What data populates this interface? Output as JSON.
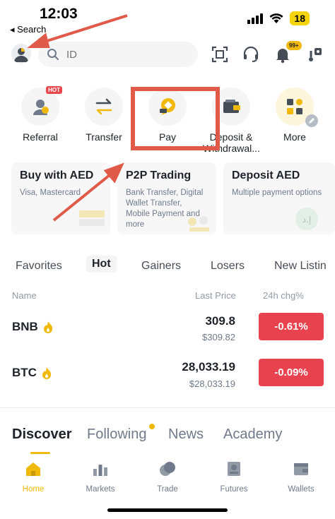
{
  "status_bar": {
    "time": "12:03",
    "back_label": "◂ Search",
    "battery": "18"
  },
  "header": {
    "search_placeholder": "ID",
    "notification_badge": "99+"
  },
  "quick_actions": [
    {
      "label": "Referral",
      "tag": "HOT"
    },
    {
      "label": "Transfer"
    },
    {
      "label": "Pay"
    },
    {
      "label": "Deposit &\nWithdrawal..."
    },
    {
      "label": "More"
    }
  ],
  "cards": [
    {
      "title": "Buy with AED",
      "subtitle": "Visa, Mastercard"
    },
    {
      "title": "P2P Trading",
      "subtitle": "Bank Transfer, Digital Wallet Transfer, Mobile Payment and more"
    },
    {
      "title": "Deposit AED",
      "subtitle": "Multiple payment options"
    }
  ],
  "market_tabs": [
    "Favorites",
    "Hot",
    "Gainers",
    "Losers",
    "New Listin"
  ],
  "market_active_tab": "Hot",
  "columns": {
    "name": "Name",
    "price": "Last Price",
    "change": "24h chg%"
  },
  "rows": [
    {
      "symbol": "BNB",
      "price": "309.8",
      "fiat": "$309.82",
      "change": "-0.61%"
    },
    {
      "symbol": "BTC",
      "price": "28,033.19",
      "fiat": "$28,033.19",
      "change": "-0.09%"
    }
  ],
  "discover_tabs": [
    "Discover",
    "Following",
    "News",
    "Academy"
  ],
  "bottom_nav": [
    "Home",
    "Markets",
    "Trade",
    "Futures",
    "Wallets"
  ],
  "colors": {
    "accent": "#f0b90b",
    "negative": "#e8424f",
    "annotation": "#e05a4a"
  }
}
